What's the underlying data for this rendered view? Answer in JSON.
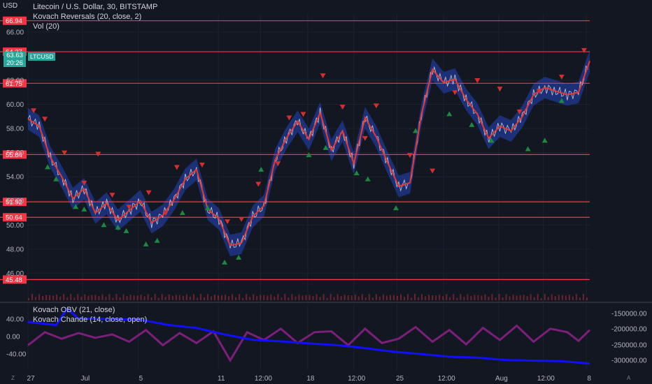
{
  "header": {
    "currency": "USD",
    "symbol_line": "Litecoin / U.S. Dollar, 30, BITSTAMP",
    "indicator_1": "Kovach Reversals (20, close, 2)",
    "indicator_2": "Vol (20)",
    "pane2_indicator_1": "Kovach OBV (21, close)",
    "pane2_indicator_2": "Kovach Chande (14, close, open)"
  },
  "price_badge": {
    "price": "63.63",
    "countdown": "20:26",
    "ticker": "LTCUSD"
  },
  "colors": {
    "background": "#131722",
    "grid": "#1e222d",
    "level_line": "#f23645",
    "price_line": "#e3e3e3",
    "band": "#1f3a93",
    "trend": "#e53935",
    "up_marker": "#1b8a3e",
    "down_marker": "#d32f2f",
    "obv": "#1010ff",
    "chande": "#7b1f7b",
    "badge": "#26a69a"
  },
  "chart_data": [
    {
      "type": "line",
      "ylim": [
        45.5,
        67.5
      ],
      "y_ticks": [
        "46.00",
        "48.00",
        "50.00",
        "52.00",
        "54.00",
        "56.00",
        "58.00",
        "60.00",
        "62.00",
        "66.00"
      ],
      "x_ticks": [
        "27",
        "Jul",
        "5",
        "11",
        "12:00",
        "18",
        "12:00",
        "25",
        "12:00",
        "Aug",
        "12:00",
        "8"
      ],
      "x_tick_pos": [
        0,
        0.097,
        0.196,
        0.339,
        0.414,
        0.498,
        0.58,
        0.657,
        0.74,
        0.838,
        0.917,
        0.994
      ],
      "levels": [
        "66.94",
        "64.37",
        "61.75",
        "55.84",
        "51.92",
        "50.64",
        "45.48"
      ],
      "series": [
        {
          "x": [
            0,
            0.02,
            0.04,
            0.06,
            0.08,
            0.1,
            0.12,
            0.14,
            0.16,
            0.18,
            0.2,
            0.22,
            0.24,
            0.26,
            0.28,
            0.3,
            0.32,
            0.34,
            0.36,
            0.38,
            0.4,
            0.42,
            0.44,
            0.46,
            0.48,
            0.5,
            0.52,
            0.54,
            0.56,
            0.58,
            0.6,
            0.62,
            0.64,
            0.66,
            0.68,
            0.7,
            0.72,
            0.74,
            0.76,
            0.78,
            0.8,
            0.82,
            0.84,
            0.86,
            0.88,
            0.9,
            0.92,
            0.94,
            0.96,
            0.98,
            1.0
          ],
          "values": [
            58.8,
            58.2,
            55.6,
            54.0,
            52.2,
            53.0,
            51.0,
            51.8,
            50.4,
            51.2,
            52.0,
            50.2,
            50.8,
            52.1,
            53.8,
            54.6,
            51.3,
            50.5,
            48.3,
            48.5,
            50.7,
            51.6,
            55.4,
            57.2,
            58.6,
            57.1,
            59.3,
            56.2,
            57.8,
            55.1,
            58.9,
            57.3,
            55.2,
            53.2,
            53.5,
            59.1,
            62.9,
            61.8,
            62.1,
            60.4,
            59.2,
            57.2,
            58.2,
            57.8,
            59.0,
            60.8,
            61.4,
            61.1,
            60.8,
            61.0,
            63.6
          ]
        }
      ],
      "up_markers": {
        "x": [
          0.035,
          0.05,
          0.085,
          0.1,
          0.135,
          0.16,
          0.175,
          0.21,
          0.23,
          0.275,
          0.32,
          0.35,
          0.375,
          0.415,
          0.5,
          0.53,
          0.585,
          0.605,
          0.655,
          0.69,
          0.75,
          0.79,
          0.825,
          0.89,
          0.92,
          0.95
        ],
        "values": [
          54.8,
          53.8,
          51.5,
          51.3,
          50.0,
          49.8,
          49.5,
          48.4,
          48.7,
          51.0,
          51.4,
          46.9,
          47.3,
          54.6,
          55.8,
          56.4,
          54.3,
          53.8,
          51.4,
          57.8,
          59.2,
          58.3,
          57.0,
          56.3,
          57.0,
          60.3
        ]
      },
      "down_markers": {
        "x": [
          0.01,
          0.03,
          0.065,
          0.1,
          0.125,
          0.15,
          0.18,
          0.215,
          0.245,
          0.265,
          0.31,
          0.355,
          0.38,
          0.41,
          0.445,
          0.465,
          0.49,
          0.525,
          0.56,
          0.6,
          0.62,
          0.68,
          0.72,
          0.76,
          0.8,
          0.84,
          0.875,
          0.91,
          0.95,
          0.99
        ],
        "values": [
          59.5,
          58.8,
          56.0,
          53.5,
          55.9,
          52.5,
          51.5,
          52.7,
          51.0,
          54.8,
          55.0,
          50.3,
          50.5,
          53.4,
          55.1,
          58.9,
          59.2,
          62.4,
          59.8,
          57.2,
          59.9,
          55.8,
          54.5,
          61.0,
          62.0,
          61.3,
          59.4,
          61.1,
          62.3,
          64.5
        ]
      }
    },
    {
      "type": "line",
      "left_ticks": [
        "40.00",
        "0.00",
        "-40.00"
      ],
      "right_ticks": [
        "-150000.00",
        "-200000.00",
        "-250000.00",
        "-300000.00"
      ],
      "series": [
        {
          "name": "Kovach OBV (21, close)",
          "x": [
            0,
            0.05,
            0.07,
            0.09,
            0.2,
            0.25,
            0.3,
            0.35,
            0.4,
            0.45,
            0.5,
            0.55,
            0.6,
            0.65,
            0.7,
            0.75,
            0.8,
            0.85,
            0.9,
            0.95,
            1.0
          ],
          "values": [
            -180000,
            -190000,
            -135000,
            -168000,
            -172000,
            -190000,
            -200000,
            -222000,
            -240000,
            -245000,
            -252000,
            -258000,
            -268000,
            -280000,
            -288000,
            -297000,
            -300000,
            -308000,
            -310000,
            -312000,
            -320000
          ]
        },
        {
          "name": "Kovach Chande (14, close, open)",
          "x": [
            0,
            0.03,
            0.06,
            0.09,
            0.12,
            0.15,
            0.18,
            0.21,
            0.24,
            0.27,
            0.3,
            0.33,
            0.36,
            0.39,
            0.42,
            0.45,
            0.48,
            0.51,
            0.54,
            0.57,
            0.6,
            0.63,
            0.66,
            0.69,
            0.72,
            0.75,
            0.78,
            0.81,
            0.84,
            0.87,
            0.9,
            0.93,
            0.96,
            0.98,
            1.0
          ],
          "values": [
            -20,
            10,
            -5,
            8,
            -3,
            5,
            -12,
            15,
            -20,
            8,
            -15,
            12,
            -55,
            10,
            -8,
            18,
            -15,
            10,
            12,
            -20,
            18,
            -15,
            -5,
            22,
            -12,
            15,
            -18,
            20,
            -8,
            25,
            -12,
            18,
            10,
            -10,
            15
          ]
        }
      ]
    }
  ]
}
